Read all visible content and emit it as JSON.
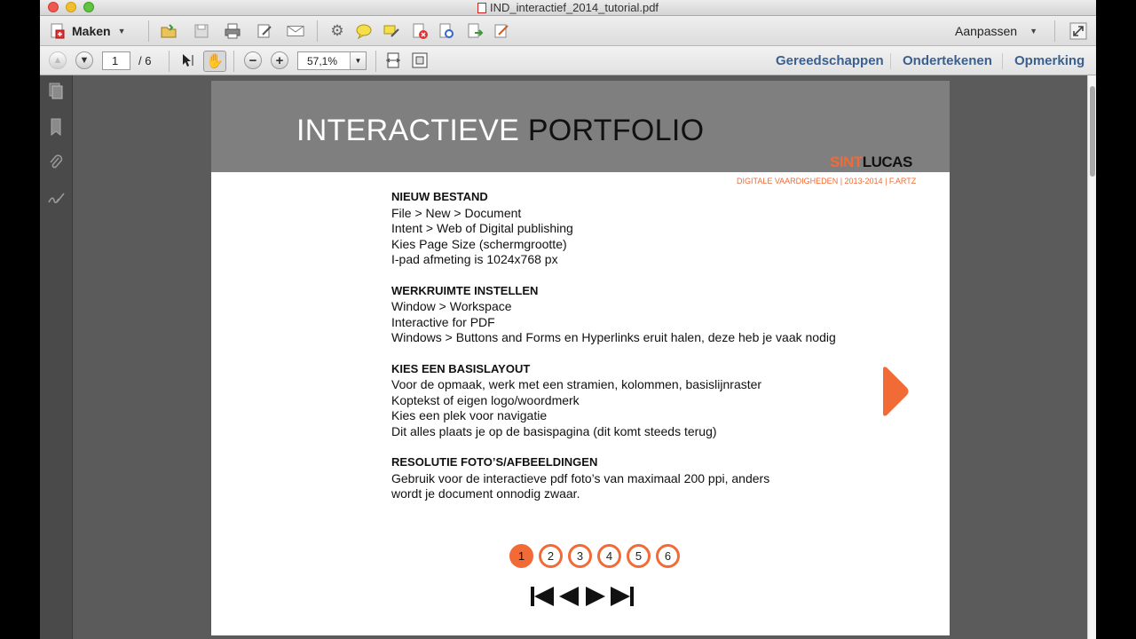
{
  "window": {
    "title": "IND_interactief_2014_tutorial.pdf"
  },
  "toolbar": {
    "maken_label": "Maken",
    "aanpassen_label": "Aanpassen",
    "icons": [
      "open-folder-icon",
      "save-icon",
      "print-icon",
      "edit-icon",
      "email-icon",
      "gear-icon",
      "comment-icon",
      "highlight-icon",
      "delete-page-icon",
      "security-icon",
      "export-icon",
      "sign-icon"
    ]
  },
  "navbar": {
    "current_page": "1",
    "total_pages": "/ 6",
    "zoom": "57,1%",
    "panels": [
      "Gereedschappen",
      "Ondertekenen",
      "Opmerking"
    ]
  },
  "document": {
    "banner_title_light": "INTERACTIEVE ",
    "banner_title_dark": "PORTFOLIO",
    "logo_sint": "SINT",
    "logo_lucas": "LUCAS",
    "subline": "DIGITALE VAARDIGHEDEN | 2013-2014 | F.ARTZ",
    "sections": [
      {
        "heading": "NIEUW BESTAND",
        "lines": [
          "File > New > Document",
          "Intent > Web of Digital publishing",
          "Kies Page Size (schermgrootte)",
          "I-pad afmeting is 1024x768 px"
        ]
      },
      {
        "heading": "WERKRUIMTE INSTELLEN",
        "lines": [
          "Window > Workspace",
          "Interactive for PDF",
          "Windows > Buttons and Forms en Hyperlinks eruit halen, deze heb je vaak nodig"
        ]
      },
      {
        "heading": "KIES EEN BASISLAYOUT",
        "lines": [
          "Voor de opmaak, werk met een stramien, kolommen, basislijnraster",
          "Koptekst of eigen logo/woordmerk",
          "Kies een plek voor navigatie",
          "Dit alles plaats je op de basispagina (dit komt steeds terug)"
        ]
      },
      {
        "heading": "RESOLUTIE FOTO’S/AFBEELDINGEN",
        "lines": [
          "Gebruik voor de interactieve pdf foto’s van maximaal 200 ppi, anders",
          "wordt je document onnodig zwaar."
        ]
      }
    ],
    "pager": [
      "1",
      "2",
      "3",
      "4",
      "5",
      "6"
    ],
    "active_page": "1",
    "accent_color": "#f26a35"
  }
}
